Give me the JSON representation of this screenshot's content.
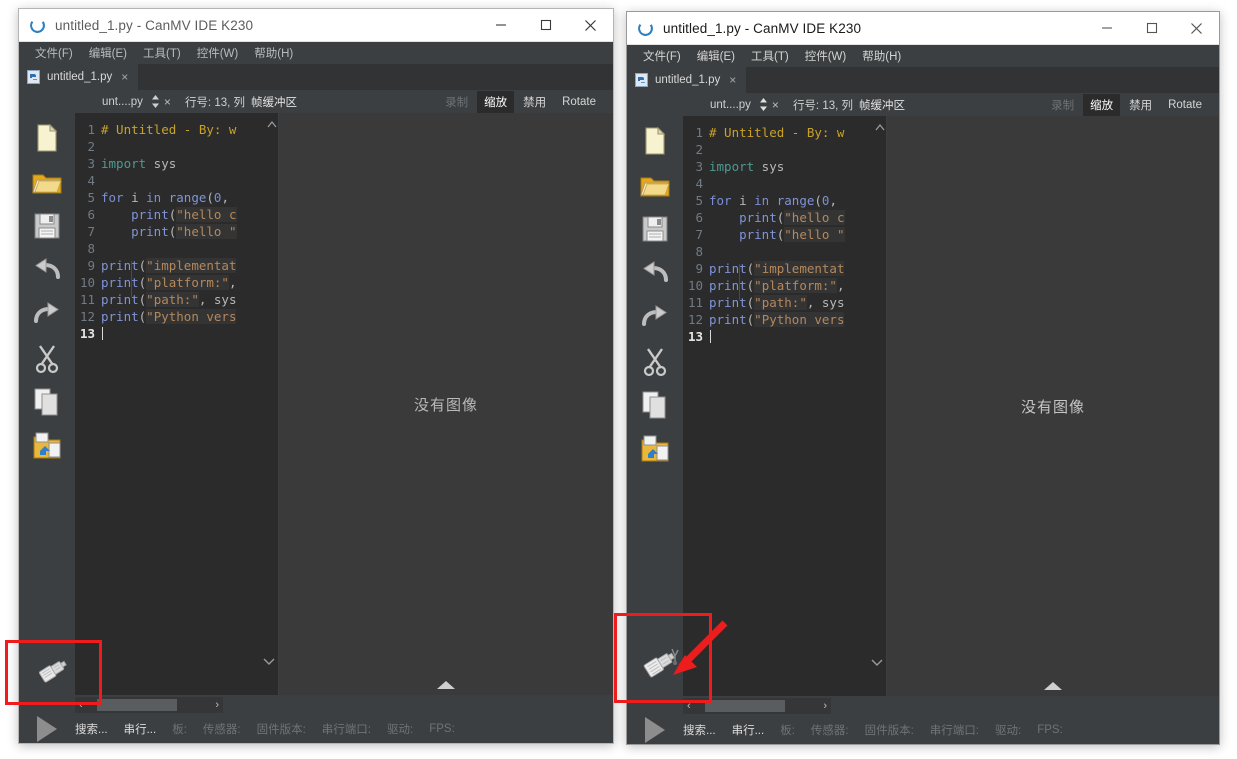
{
  "app": {
    "title": "untitled_1.py - CanMV IDE K230",
    "app_icon": "canmv-logo-icon"
  },
  "window_controls": {
    "minimize": "minimize-icon",
    "maximize": "maximize-icon",
    "close": "close-icon"
  },
  "menubar": {
    "items": [
      {
        "label": "文件(F)",
        "name": "menu-file"
      },
      {
        "label": "编辑(E)",
        "name": "menu-edit"
      },
      {
        "label": "工具(T)",
        "name": "menu-tools"
      },
      {
        "label": "控件(W)",
        "name": "menu-widgets"
      },
      {
        "label": "帮助(H)",
        "name": "menu-help"
      }
    ]
  },
  "filetab": {
    "label": "untitled_1.py",
    "close": "×",
    "icon": "python-file-icon"
  },
  "subbar": {
    "file_label": "unt....py",
    "spinner": "updown-spinner-icon",
    "close": "×",
    "line_status": "行号: 13, 列",
    "framebuffer_label": "帧缓冲区",
    "buttons": [
      {
        "label": "录制",
        "name": "record-button",
        "state": "disabled"
      },
      {
        "label": "缩放",
        "name": "zoom-button",
        "state": "selected"
      },
      {
        "label": "禁用",
        "name": "disable-button",
        "state": "normal"
      },
      {
        "label": "Rotate",
        "name": "rotate-button",
        "state": "normal"
      }
    ]
  },
  "vtoolbar": {
    "items": [
      {
        "name": "new-file-icon",
        "label": "新建"
      },
      {
        "name": "open-folder-icon",
        "label": "打开"
      },
      {
        "name": "save-icon",
        "label": "保存"
      },
      {
        "name": "undo-icon",
        "label": "撤销"
      },
      {
        "name": "redo-icon",
        "label": "重做"
      },
      {
        "name": "cut-icon",
        "label": "剪切"
      },
      {
        "name": "copy-icon",
        "label": "复制"
      },
      {
        "name": "paste-icon",
        "label": "粘贴"
      }
    ],
    "connect": {
      "name": "connect-device-icon",
      "label": "连接开发板"
    },
    "run": {
      "name": "run-icon",
      "label": "运行"
    }
  },
  "editor": {
    "lines": [
      {
        "n": "1",
        "tokens": [
          {
            "t": "# Untitled - By: w",
            "c": "cm"
          }
        ]
      },
      {
        "n": "2",
        "tokens": []
      },
      {
        "n": "3",
        "tokens": [
          {
            "t": "import",
            "c": "im"
          },
          {
            "t": " sys",
            "c": "pl"
          }
        ]
      },
      {
        "n": "4",
        "tokens": []
      },
      {
        "n": "5",
        "tokens": [
          {
            "t": "for",
            "c": "kw"
          },
          {
            "t": " i ",
            "c": "pl"
          },
          {
            "t": "in",
            "c": "kw"
          },
          {
            "t": " ",
            "c": "pl"
          },
          {
            "t": "range",
            "c": "fn"
          },
          {
            "t": "(",
            "c": "pl"
          },
          {
            "t": "0",
            "c": "num"
          },
          {
            "t": ",",
            "c": "pl"
          }
        ]
      },
      {
        "n": "6",
        "tokens": [
          {
            "t": "    ",
            "c": "pl"
          },
          {
            "t": "print",
            "c": "fn"
          },
          {
            "t": "(",
            "c": "pl"
          },
          {
            "t": "\"hello c",
            "c": "st"
          }
        ]
      },
      {
        "n": "7",
        "tokens": [
          {
            "t": "    ",
            "c": "pl"
          },
          {
            "t": "print",
            "c": "fn"
          },
          {
            "t": "(",
            "c": "pl"
          },
          {
            "t": "\"hello \"",
            "c": "st"
          }
        ]
      },
      {
        "n": "8",
        "tokens": []
      },
      {
        "n": "9",
        "tokens": [
          {
            "t": "print",
            "c": "fn"
          },
          {
            "t": "(",
            "c": "pl"
          },
          {
            "t": "\"implementat",
            "c": "st"
          }
        ]
      },
      {
        "n": "10",
        "tokens": [
          {
            "t": "print",
            "c": "fn"
          },
          {
            "t": "(",
            "c": "pl"
          },
          {
            "t": "\"platform:\"",
            "c": "st"
          },
          {
            "t": ",",
            "c": "pl"
          }
        ]
      },
      {
        "n": "11",
        "tokens": [
          {
            "t": "print",
            "c": "fn"
          },
          {
            "t": "(",
            "c": "pl"
          },
          {
            "t": "\"path:\"",
            "c": "st"
          },
          {
            "t": ", sys",
            "c": "pl"
          }
        ]
      },
      {
        "n": "12",
        "tokens": [
          {
            "t": "print",
            "c": "fn"
          },
          {
            "t": "(",
            "c": "pl"
          },
          {
            "t": "\"Python vers",
            "c": "st"
          }
        ]
      },
      {
        "n": "13",
        "tokens": [],
        "current": true,
        "caret": true
      }
    ],
    "scroll_up": "▲",
    "scroll_down": "▼"
  },
  "viewer": {
    "empty_text": "没有图像",
    "collapse": "collapse-triangle-icon"
  },
  "statusbar": {
    "items": [
      {
        "label": "搜索...",
        "name": "status-search",
        "state": "bright"
      },
      {
        "label": "串行...",
        "name": "status-serial",
        "state": "bright"
      },
      {
        "label": "板:",
        "name": "status-board",
        "state": "dim"
      },
      {
        "label": "传感器:",
        "name": "status-sensor",
        "state": "dim"
      },
      {
        "label": "固件版本:",
        "name": "status-firmware",
        "state": "dim"
      },
      {
        "label": "串行端口:",
        "name": "status-serialport",
        "state": "dim"
      },
      {
        "label": "驱动:",
        "name": "status-driver",
        "state": "dim"
      },
      {
        "label": "FPS:",
        "name": "status-fps",
        "state": "dim"
      }
    ],
    "hscroll_left": "‹",
    "hscroll_right": "›"
  },
  "annotations": {
    "left_highlight": {
      "name": "connect-button-highlight",
      "color": "#ee1c1c"
    },
    "right_highlight": {
      "name": "connect-button-highlight",
      "color": "#ee1c1c"
    },
    "arrow": {
      "name": "pointer-arrow",
      "color": "#ee1c1c"
    }
  },
  "colors": {
    "accent_red": "#ee1c1c",
    "window_bg": "#3c3f41",
    "editor_bg": "#2b2b2b",
    "viewer_bg": "#3a3a3a",
    "comment": "#c9a227",
    "string": "#b4885c",
    "keyword": "#7a8fd4",
    "import": "#4e9a8f"
  }
}
